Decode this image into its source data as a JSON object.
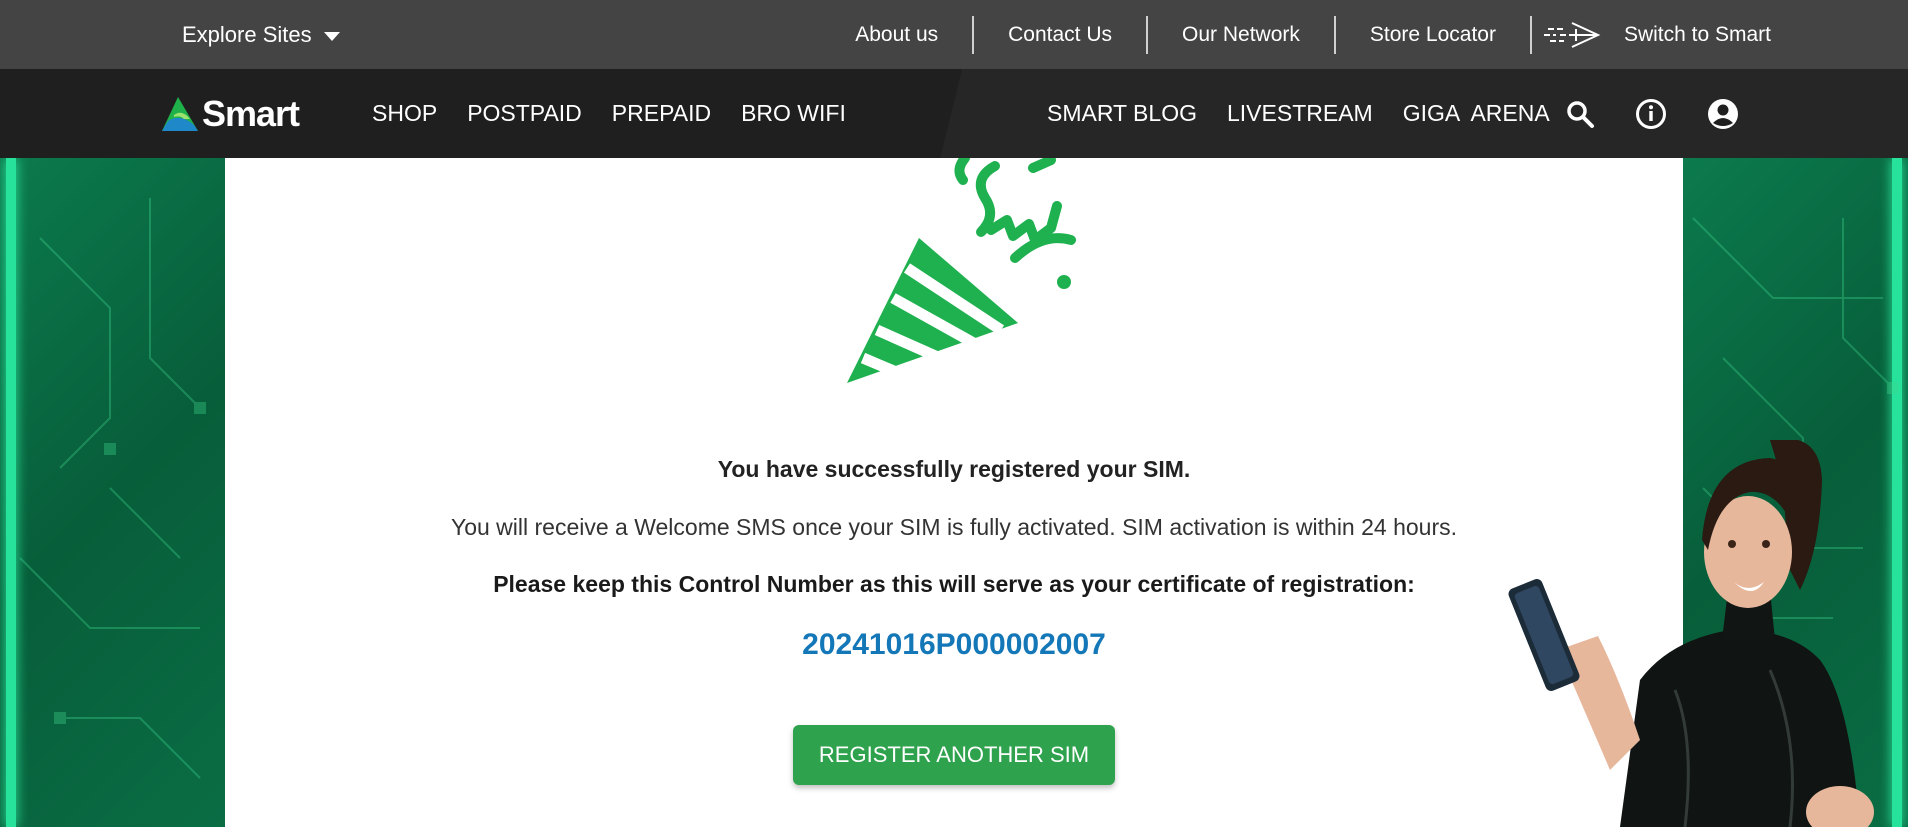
{
  "topbar": {
    "explore_label": "Explore Sites",
    "links": [
      "About us",
      "Contact Us",
      "Our Network",
      "Store Locator"
    ],
    "switch_label": "Switch to Smart"
  },
  "navbar": {
    "logo_text": "Smart",
    "left_items": [
      "SHOP",
      "POSTPAID",
      "PREPAID",
      "BRO WIFI"
    ],
    "right_items": [
      "SMART BLOG",
      "LIVESTREAM",
      "GIGA  ARENA"
    ],
    "icons": [
      "search-icon",
      "info-icon",
      "account-icon"
    ]
  },
  "content": {
    "title": "You have successfully registered your SIM.",
    "subtitle": "You will receive a Welcome SMS once your SIM is fully activated. SIM activation is within 24 hours.",
    "keep_text": "Please keep this Control Number as this will serve as your certificate of registration:",
    "control_number": "20241016P000002007",
    "register_button": "REGISTER ANOTHER SIM"
  },
  "colors": {
    "brand_green": "#2fa24d",
    "control_blue": "#1477b8",
    "topbar_bg": "#444444",
    "navbar_bg": "#1f1f1f"
  }
}
